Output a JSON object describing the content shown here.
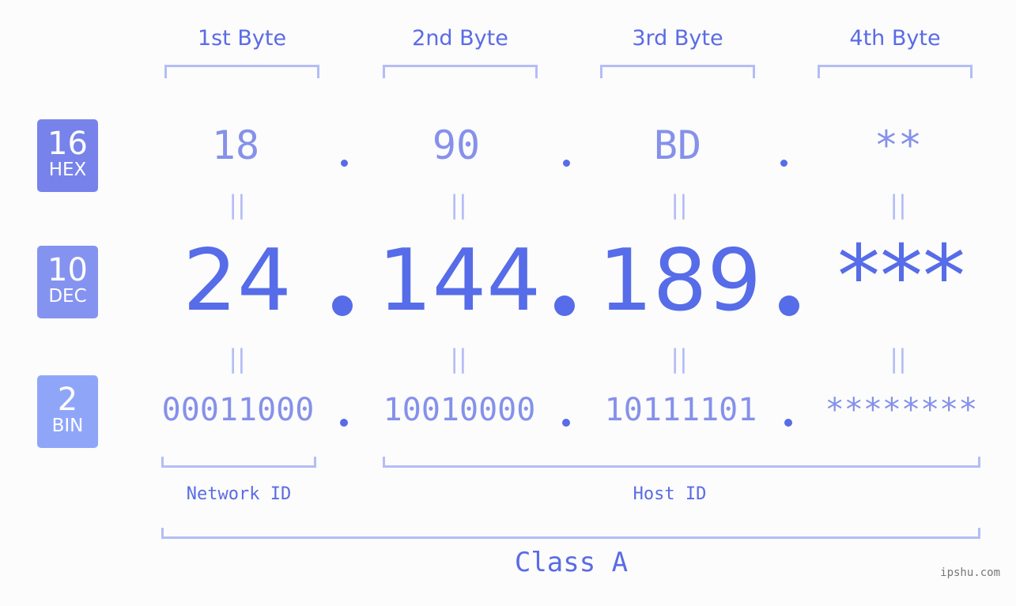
{
  "byte_headers": [
    "1st Byte",
    "2nd Byte",
    "3rd Byte",
    "4th Byte"
  ],
  "rows": {
    "hex": {
      "base": "16",
      "label": "HEX",
      "values": [
        "18",
        "90",
        "BD",
        "**"
      ],
      "color": "#7783ea"
    },
    "dec": {
      "base": "10",
      "label": "DEC",
      "values": [
        "24",
        "144",
        "189",
        "***"
      ],
      "color": "#8593f0"
    },
    "bin": {
      "base": "2",
      "label": "BIN",
      "values": [
        "00011000",
        "10010000",
        "10111101",
        "********"
      ],
      "color": "#8fa6f8"
    }
  },
  "equals_sign": "||",
  "segments": {
    "network_id": "Network ID",
    "host_id": "Host ID",
    "class": "Class A"
  },
  "watermark": "ipshu.com",
  "colors": {
    "accent": "#566ce8",
    "light_value": "#8591ea",
    "bracket": "#b4bdf6",
    "background": "#fbfcfb"
  }
}
